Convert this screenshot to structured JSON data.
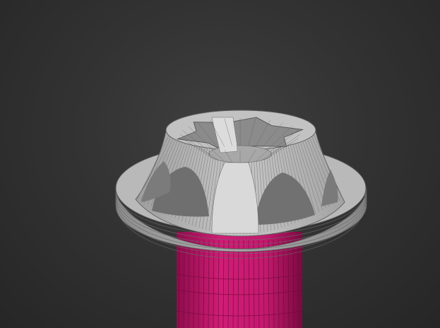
{
  "viewport": {
    "label": "",
    "background_color": "#333333"
  },
  "scene": {
    "object": "screw",
    "components": [
      "head-flange",
      "drive-recess",
      "shank"
    ],
    "drive_lobe_count": 6,
    "colors": {
      "head": "#b4b4b4",
      "head_highlight": "#d6d6d6",
      "head_shadow": "#8a8a8a",
      "wire": "#555555",
      "shank": "#c8196e",
      "shank_wire": "#7a0a3e"
    },
    "display_mode": "shaded-with-wireframe"
  }
}
